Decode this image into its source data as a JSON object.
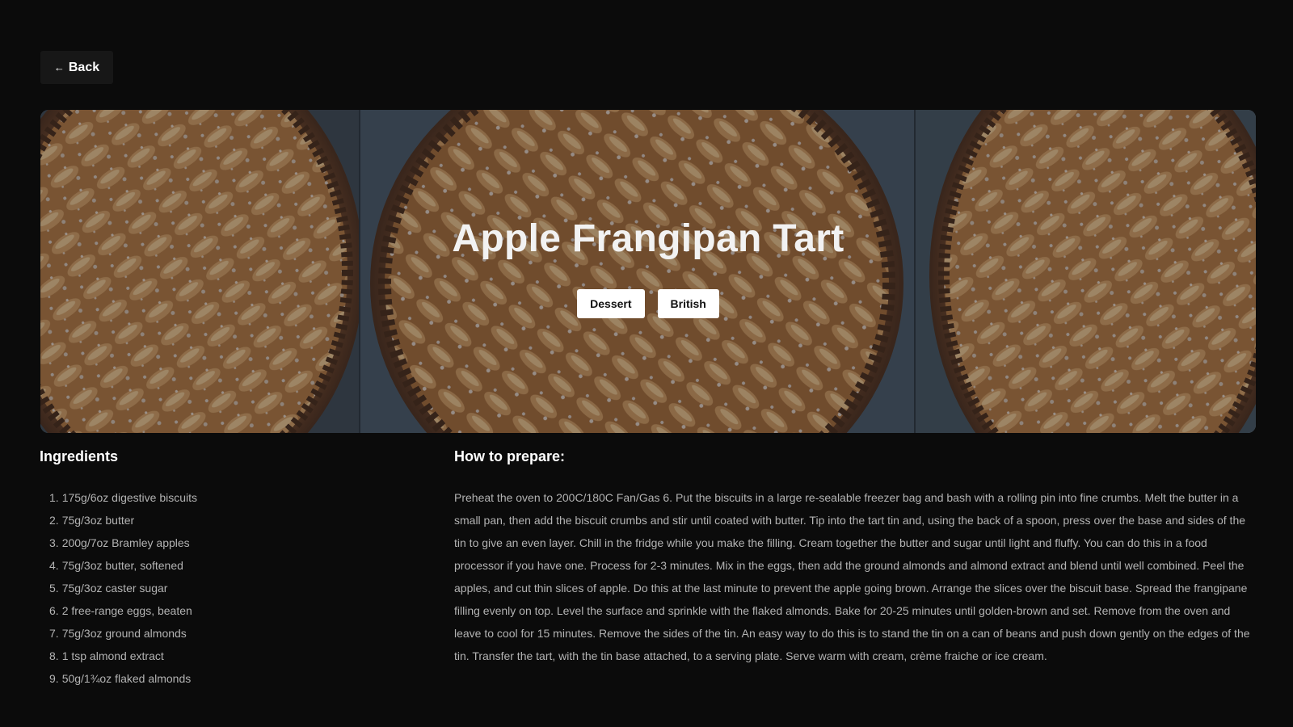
{
  "back_button": {
    "arrow": "←",
    "label": "Back"
  },
  "hero": {
    "image_subject": "apple-frangipane-tart-photo",
    "title": "Apple Frangipan Tart",
    "tags": [
      "Dessert",
      "British"
    ]
  },
  "ingredients": {
    "heading": "Ingredients",
    "items": [
      {
        "num": "1.",
        "text": "175g/6oz digestive biscuits"
      },
      {
        "num": "2.",
        "text": "75g/3oz butter"
      },
      {
        "num": "3.",
        "text": "200g/7oz Bramley apples"
      },
      {
        "num": "4.",
        "text": "75g/3oz butter, softened"
      },
      {
        "num": "5.",
        "text": "75g/3oz caster sugar"
      },
      {
        "num": "6.",
        "text": "2 free-range eggs, beaten"
      },
      {
        "num": "7.",
        "text": "75g/3oz ground almonds"
      },
      {
        "num": "8.",
        "text": "1 tsp almond extract"
      },
      {
        "num": "9.",
        "text": "50g/1¾oz flaked almonds"
      }
    ]
  },
  "prepare": {
    "heading": "How to prepare:",
    "text": "Preheat the oven to 200C/180C Fan/Gas 6. Put the biscuits in a large re-sealable freezer bag and bash with a rolling pin into fine crumbs. Melt the butter in a small pan, then add the biscuit crumbs and stir until coated with butter. Tip into the tart tin and, using the back of a spoon, press over the base and sides of the tin to give an even layer. Chill in the fridge while you make the filling. Cream together the butter and sugar until light and fluffy. You can do this in a food processor if you have one. Process for 2-3 minutes. Mix in the eggs, then add the ground almonds and almond extract and blend until well combined. Peel the apples, and cut thin slices of apple. Do this at the last minute to prevent the apple going brown. Arrange the slices over the biscuit base. Spread the frangipane filling evenly on top. Level the surface and sprinkle with the flaked almonds. Bake for 20-25 minutes until golden-brown and set. Remove from the oven and leave to cool for 15 minutes. Remove the sides of the tin. An easy way to do this is to stand the tin on a can of beans and push down gently on the edges of the tin. Transfer the tart, with the tin base attached, to a serving plate. Serve warm with cream, crème fraiche or ice cream."
  },
  "colors": {
    "page_background": "#0b0b0b",
    "button_background": "#171717",
    "tag_background": "#ffffff",
    "body_text": "#b3b3b3"
  }
}
